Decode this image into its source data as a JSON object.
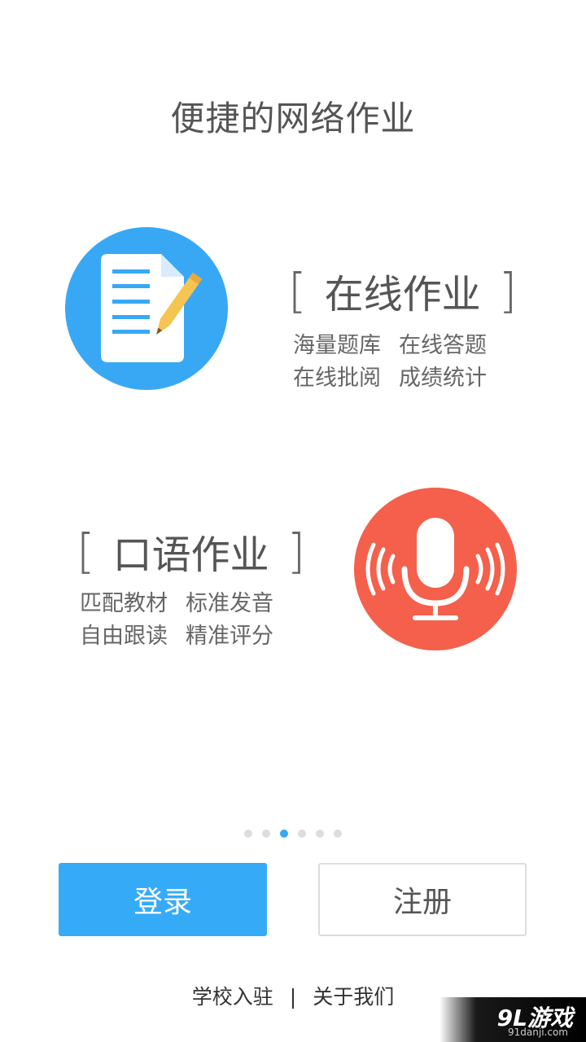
{
  "header": {
    "title": "便捷的网络作业"
  },
  "features": [
    {
      "title": "在线作业",
      "icon": "homework-document-icon",
      "color": "#38a8f5",
      "lines": [
        [
          "海量题库",
          "在线答题"
        ],
        [
          "在线批阅",
          "成绩统计"
        ]
      ]
    },
    {
      "title": "口语作业",
      "icon": "microphone-icon",
      "color": "#f4604b",
      "lines": [
        [
          "匹配教材",
          "标准发音"
        ],
        [
          "自由跟读",
          "精准评分"
        ]
      ]
    }
  ],
  "brackets": {
    "open": "[",
    "close": "]"
  },
  "pager": {
    "count": 6,
    "active_index": 2,
    "active_color": "#38a8f5"
  },
  "buttons": {
    "login_label": "登录",
    "register_label": "注册"
  },
  "footer": {
    "school_join": "学校入驻",
    "separator": "|",
    "about_us": "关于我们"
  },
  "watermark": {
    "logo": "9L游戏",
    "url": "91danji.com"
  }
}
